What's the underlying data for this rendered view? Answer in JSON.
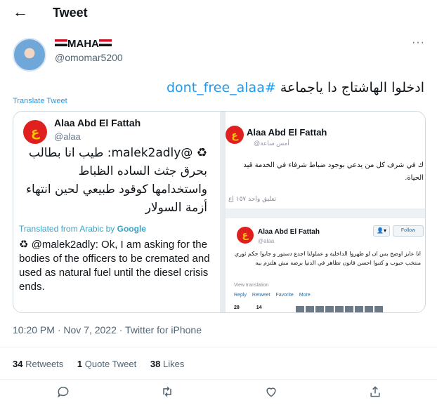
{
  "header": {
    "title": "Tweet",
    "back_icon": "arrow-left-icon"
  },
  "author": {
    "name": "MAHA",
    "handle": "@omomar5200",
    "more": "···"
  },
  "tweet": {
    "text_arabic": "ادخلوا الهاشتاج دا ياجماعة",
    "hashtag": "#dont_free_alaa",
    "translate_label": "Translate Tweet"
  },
  "media": {
    "left": {
      "name": "Alaa Abd El Fattah",
      "handle": "@alaa",
      "arabic": "♻ @malek2adly: طيب انا بطالب بحرق جثث الساده الظباط واستخدامها كوقود طبيعي لحين انتهاء أزمة السولار",
      "translated_from": "Translated from Arabic by",
      "google": "Google",
      "english": "♻ @malek2adly: Ok, I am asking for the bodies of the officers to be cremated and used as natural fuel until the diesel crisis ends."
    },
    "right_top": {
      "name": "Alaa Abd El Fattah",
      "sub": "@أمس ساعة",
      "text": "ك في شرف كل من يدعي بوجود ضباط شرفاء في الخدمة قيد الحياة.",
      "stats": "تعليق واحد  ١٥٧ إع"
    },
    "right_bottom": {
      "name": "Alaa Abd El Fattah",
      "handle": "@alaa",
      "follow": "Follow",
      "text": "انا عايز اوضح بس ان لو طهروا الداخلية و عملولنا اجدع دستور و جابوا حكم ثوري منتخب حبوب و كتبوا احسن قانون تظاهر في الدنيا برضه مش هلتزم بيه",
      "view_translation": "View translation",
      "actions": [
        "Reply",
        "Retweet",
        "Favorite",
        "More"
      ],
      "counts": [
        "28",
        "14"
      ]
    }
  },
  "meta": {
    "time": "10:20 PM · Nov 7, 2022 · Twitter for iPhone"
  },
  "stats": {
    "retweets_count": "34",
    "retweets_label": "Retweets",
    "quotes_count": "1",
    "quotes_label": "Quote Tweet",
    "likes_count": "38",
    "likes_label": "Likes"
  },
  "actions": [
    "reply-icon",
    "retweet-icon",
    "like-icon",
    "share-icon"
  ],
  "colors": {
    "accent": "#1d9bf0",
    "secondary_text": "#536471",
    "logo_red": "#e0201e"
  }
}
